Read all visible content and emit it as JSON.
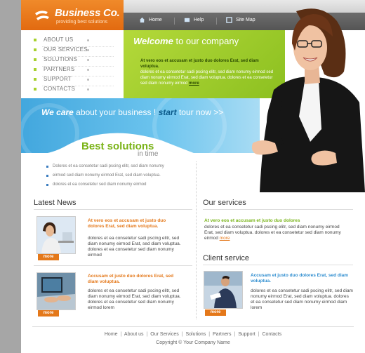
{
  "brand": {
    "name": "Business Co.",
    "tagline": "providing best solutions"
  },
  "top_nav": [
    {
      "label": "Home",
      "icon": "house-icon"
    },
    {
      "label": "Help",
      "icon": "help-icon"
    },
    {
      "label": "Site Map",
      "icon": "sitemap-icon"
    }
  ],
  "side_menu": [
    "ABOUT US",
    "OUR SERVICES",
    "SOLUTIONS",
    "PARTNERS",
    "SUPPORT",
    "CONTACTS"
  ],
  "welcome": {
    "title_bold": "Welcome",
    "title_rest": "to our company",
    "lead": "At vero eos et accusam et justo duo dolores Erat, sed diam voluptua.",
    "text": "dolores et ea consetetur sadi pscing elitr, sed diam nonumy eirmod sed diam nonumy eirmod Erat, sed diam voluptua. dolores et ea consetetur sed diam nonumy eirmod",
    "more": "more"
  },
  "banner": {
    "we_care": "We care",
    "middle": "about your business !",
    "start": "start",
    "tour": "tour now >>"
  },
  "best": {
    "title": "Best solutions",
    "subtitle": "in time",
    "items": [
      "Dolores et ea consetetur sadi pscing elitr, sed diam nonumy",
      "eirmod sed diam nonumy eirmod Erat, sed diam voluptua.",
      "dolores et ea consetetur sed diam nonumy eirmod"
    ]
  },
  "latest_news": {
    "heading": "Latest News",
    "items": [
      {
        "title": "At vero eos et accusam et justo duo dolores Erat, sed diam voluptua.",
        "text": "dolores et ea consetetur sadi pscing elitr, sed diam nonumy eirmod Erat, sed diam voluptua. dolores et ea consetetur sed diam nonumy eirmod",
        "more": "more"
      },
      {
        "title": "Accusam et justo duo dolores Erat, sed diam voluptua.",
        "text": "dolores et ea consetetur sadi pscing elitr, sed diam nonumy eirmod Erat, sed diam voluptua. dolores et ea consetetur sed diam nonumy eirmod lorem",
        "more": "more"
      }
    ]
  },
  "our_services": {
    "heading": "Our services",
    "title": "At vero eos et accusam et justo duo dolores",
    "text": "dolores et ea consetetur sadi pscing elitr, sed diam nonumy eirmod Erat, sed diam voluptua. dolores et ea consetetur sed diam nonumy eirmod",
    "more": "more"
  },
  "client_service": {
    "heading": "Client service",
    "title": "Accusam et justo duo dolores Erat, sed diam voluptua.",
    "text": "dolores et ea consetetur sadi pscing elitr, sed diam nonumy eirmod Erat, sed diam voluptua. dolores et ea consetetur sed diam nonumy eirmod diam lorem",
    "more": "more"
  },
  "footer": {
    "links": [
      "Home",
      "About us",
      "Our Services",
      "Solutions",
      "Partners",
      "Support",
      "Contacts"
    ],
    "copyright": "Copyright © Your Company Name"
  },
  "colors": {
    "orange": "#e4781a",
    "green": "#8cc020",
    "blue": "#3ea4dc",
    "sidebar_gray": "#a6a6a6"
  }
}
